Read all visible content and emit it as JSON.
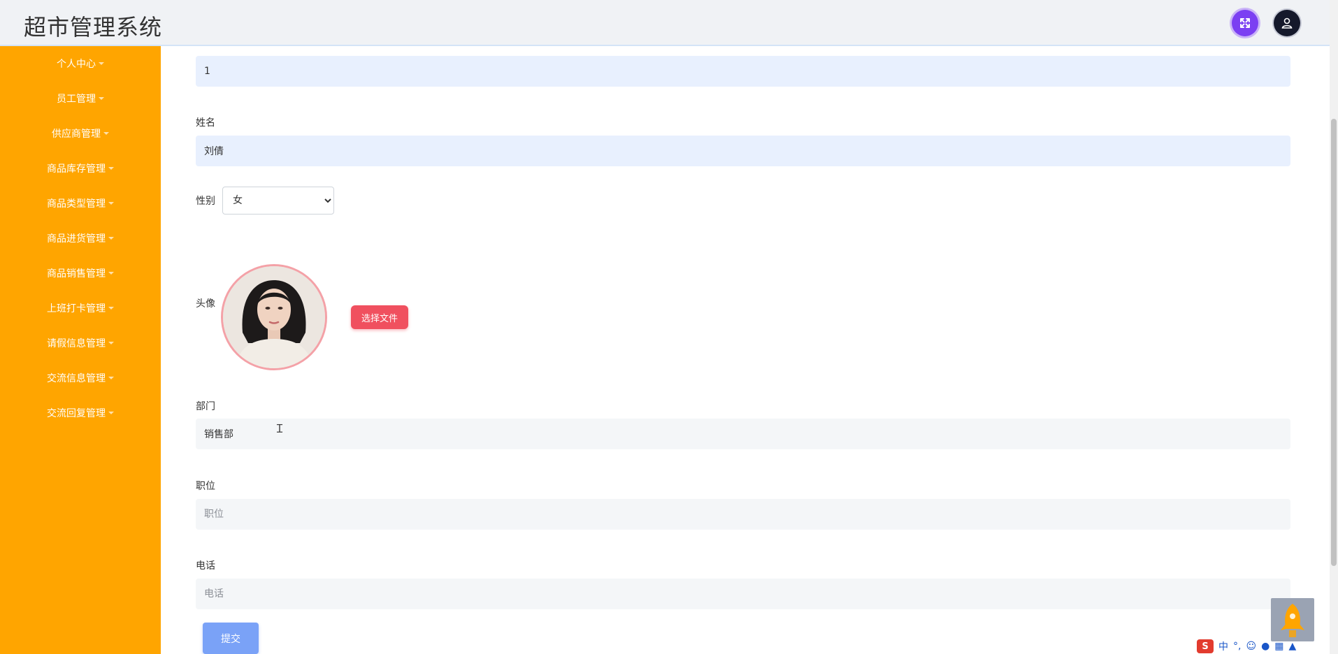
{
  "header": {
    "title": "超市管理系统",
    "expand_icon": "expand-icon",
    "user_icon": "user-icon"
  },
  "sidebar": {
    "items": [
      {
        "label": "个人中心"
      },
      {
        "label": "员工管理"
      },
      {
        "label": "供应商管理"
      },
      {
        "label": "商品库存管理"
      },
      {
        "label": "商品类型管理"
      },
      {
        "label": "商品进货管理"
      },
      {
        "label": "商品销售管理"
      },
      {
        "label": "上班打卡管理"
      },
      {
        "label": "请假信息管理"
      },
      {
        "label": "交流信息管理"
      },
      {
        "label": "交流回复管理"
      }
    ]
  },
  "form": {
    "id_value": "1",
    "name_label": "姓名",
    "name_value": "刘倩",
    "gender_label": "性别",
    "gender_value": "女",
    "avatar_label": "头像",
    "choose_file_label": "选择文件",
    "department_label": "部门",
    "department_value": "销售部",
    "position_label": "职位",
    "position_placeholder": "职位",
    "phone_label": "电话",
    "phone_placeholder": "电话",
    "submit_label": "提交"
  },
  "tray": {
    "ime_label": "中",
    "ime_icon": "sogou-ime-icon"
  },
  "colors": {
    "sidebar_bg": "#ffa500",
    "header_bg": "#f0f2f5",
    "expand_button": "#7b3ff2",
    "user_button": "#15192b",
    "file_button": "#f0505f",
    "submit_button": "#7aa2f7"
  }
}
